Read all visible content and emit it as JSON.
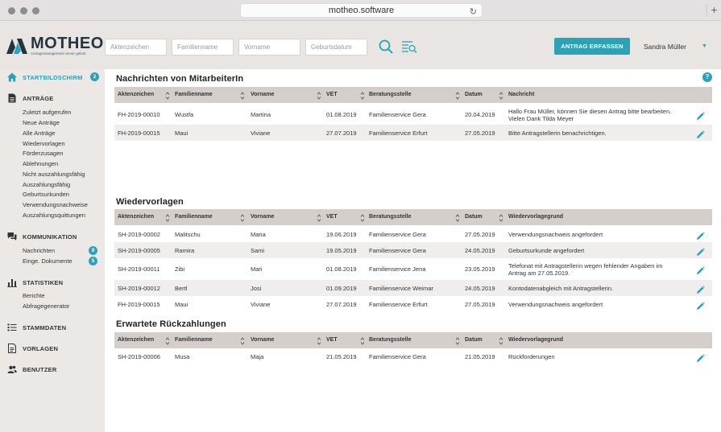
{
  "browser": {
    "url": "motheo.software"
  },
  "header": {
    "logo_text": "MOTHEO",
    "logo_tagline": "Antragsmanagement clever gelöst",
    "placeholders": {
      "aktenzeichen": "Aktenzeichen",
      "familienname": "Familienname",
      "vorname": "Vorname",
      "geburtsdatum": "Geburtsdatum"
    },
    "search_icon": "search-icon",
    "filter_icon": "filter-list-icon",
    "primary_button": "ANTRAG ERFASSEN",
    "user_name": "Sandra Müller",
    "accent_color": "#2aa2b8"
  },
  "sidebar": {
    "start": {
      "label": "STARTBILDSCHIRM",
      "badge": "2",
      "icon": "home-icon"
    },
    "antraege": {
      "label": "ANTRÄGE",
      "icon": "document-icon",
      "items": [
        "Zuletzt aufgerufen",
        "Neue Anträge",
        "Alle Anträge",
        "Wiedervorlagen",
        "Förderzusagen",
        "Ablehnungen",
        "Nicht auszahlungsfähig",
        "Auszahlungsfähig",
        "Geburtsurkunden",
        "Verwendungsnachweise",
        "Auszahlungsquittungen"
      ]
    },
    "kommunikation": {
      "label": "KOMMUNIKATION",
      "icon": "chat-icon",
      "items": [
        {
          "label": "Nachrichten",
          "badge": "9"
        },
        {
          "label": "Einge. Dokumente",
          "badge": "5"
        }
      ]
    },
    "statistiken": {
      "label": "STATISTIKEN",
      "icon": "bar-chart-icon",
      "items": [
        "Berichte",
        "Abfragegenerator"
      ]
    },
    "stammdaten": {
      "label": "STAMMDATEN",
      "icon": "list-icon"
    },
    "vorlagen": {
      "label": "VORLAGEN",
      "icon": "template-icon"
    },
    "benutzer": {
      "label": "BENUTZER",
      "icon": "users-icon"
    }
  },
  "main": {
    "help_label": "?",
    "nachrichten": {
      "title": "Nachrichten von MitarbeiterIn",
      "columns": [
        "Aktenzeichen",
        "Familienname",
        "Vorname",
        "VET",
        "Beratungsstelle",
        "Datum",
        "Nachricht"
      ],
      "rows": [
        {
          "az": "FH-2019-00010",
          "fam": "Wustfa",
          "vor": "Martina",
          "vet": "01.08.2019",
          "ber": "Familienservice Gera",
          "dat": "20.04.2019",
          "msg1": "Hallo Frau Müller, können Sie diesen Antrag bitte bearbeiten.",
          "msg2": "Vielen Dank Tilda Meyer"
        },
        {
          "az": "FH-2019-00015",
          "fam": "Maui",
          "vor": "Viviane",
          "vet": "27.07.2019",
          "ber": "Familienservice Erfurt",
          "dat": "27.05.2019",
          "msg1": "Bitte Antragstellerin benachrichtigen.",
          "msg2": ""
        }
      ]
    },
    "wiedervorlagen": {
      "title": "Wiedervorlagen",
      "columns": [
        "Aktenzeichen",
        "Familienname",
        "Vorname",
        "VET",
        "Beratungsstelle",
        "Datum",
        "Wiedervorlagegrund"
      ],
      "rows": [
        {
          "az": "SH-2019-00002",
          "fam": "Malitschu",
          "vor": "Maria",
          "vet": "19.06.2019",
          "ber": "Familienservice Gera",
          "dat": "27.05.2019",
          "msg1": "Verwendungsnachweis angefordert",
          "msg2": ""
        },
        {
          "az": "SH-2019-00005",
          "fam": "Ramira",
          "vor": "Sami",
          "vet": "19.05.2019",
          "ber": "Familienservice Gera",
          "dat": "24.05.2019",
          "msg1": "Geburtsurkunde angefordert",
          "msg2": ""
        },
        {
          "az": "SH-2019-00011",
          "fam": "Zibi",
          "vor": "Mari",
          "vet": "01.08.2019",
          "ber": "Familienservice Jena",
          "dat": "23.05.2019",
          "msg1": "Telefonat mit Antragstellerin wegen fehlender Angaben im",
          "msg2": "Antrag am 27.05.2019."
        },
        {
          "az": "SH-2019-00012",
          "fam": "Bertl",
          "vor": "Josi",
          "vet": "01.09.2019",
          "ber": "Familienservice Weimar",
          "dat": "24.05.2019",
          "msg1": "Kontodatenabgleich mit Antragstellerin.",
          "msg2": ""
        },
        {
          "az": "FH-2019-00015",
          "fam": "Maui",
          "vor": "Viviane",
          "vet": "27.07.2019",
          "ber": "Familienservice Erfurt",
          "dat": "27.05.2019",
          "msg1": "Verwendungsnachweis angefordert",
          "msg2": ""
        }
      ]
    },
    "rueckzahlungen": {
      "title": "Erwartete Rückzahlungen",
      "columns": [
        "Aktenzeichen",
        "Familienname",
        "Vorname",
        "VET",
        "Beratungsstelle",
        "Datum",
        "Wiedervorlagegrund"
      ],
      "rows": [
        {
          "az": "SH-2019-00006",
          "fam": "Musa",
          "vor": "Maja",
          "vet": "21.05.2019",
          "ber": "Familienservice Gera",
          "dat": "21.05.2019",
          "msg1": "Rückforderungen",
          "msg2": ""
        }
      ]
    },
    "edit_icon": "pencil-icon"
  }
}
